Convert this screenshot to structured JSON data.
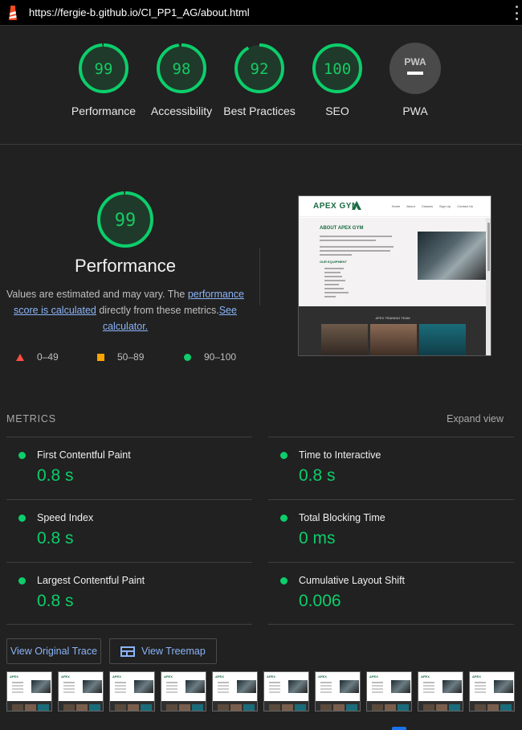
{
  "browser": {
    "url": "https://fergie-b.github.io/CI_PP1_AG/about.html"
  },
  "colors": {
    "pass": "#0cce6b",
    "average": "#ffa400",
    "fail": "#ff4e42",
    "link": "#8ab4f8",
    "pwa_gray": "#4a4a4a"
  },
  "categories": [
    {
      "score": "99",
      "label": "Performance"
    },
    {
      "score": "98",
      "label": "Accessibility"
    },
    {
      "score": "92",
      "label": "Best Practices"
    },
    {
      "score": "100",
      "label": "SEO"
    },
    {
      "score": "PWA",
      "label": "PWA"
    }
  ],
  "performance": {
    "score": "99",
    "title": "Performance",
    "desc_prefix": "Values are estimated and may vary. The ",
    "desc_link1": "performance score is calculated",
    "desc_middle": " directly from these metrics.",
    "desc_link2": "See calculator.",
    "legend": [
      {
        "icon": "triangle-icon",
        "range": "0–49"
      },
      {
        "icon": "square-icon",
        "range": "50–89"
      },
      {
        "icon": "circle-icon",
        "range": "90–100"
      }
    ]
  },
  "preview": {
    "logo": "APEX GYM",
    "nav": [
      "Home",
      "About",
      "Classes",
      "Sign Up",
      "Contact Us"
    ],
    "heading": "ABOUT APEX GYM",
    "subheading": "OUR EQUIPMENT",
    "team_heading": "APEX TRAINING TEAM"
  },
  "metrics": {
    "heading": "METRICS",
    "expand_label": "Expand view",
    "items": [
      {
        "name": "First Contentful Paint",
        "value": "0.8 s"
      },
      {
        "name": "Time to Interactive",
        "value": "0.8 s"
      },
      {
        "name": "Speed Index",
        "value": "0.8 s"
      },
      {
        "name": "Total Blocking Time",
        "value": "0 ms"
      },
      {
        "name": "Largest Contentful Paint",
        "value": "0.8 s"
      },
      {
        "name": "Cumulative Layout Shift",
        "value": "0.006"
      }
    ]
  },
  "buttons": {
    "trace": "View Original Trace",
    "treemap": "View Treemap"
  },
  "filmstrip": {
    "logo": "APEX"
  }
}
